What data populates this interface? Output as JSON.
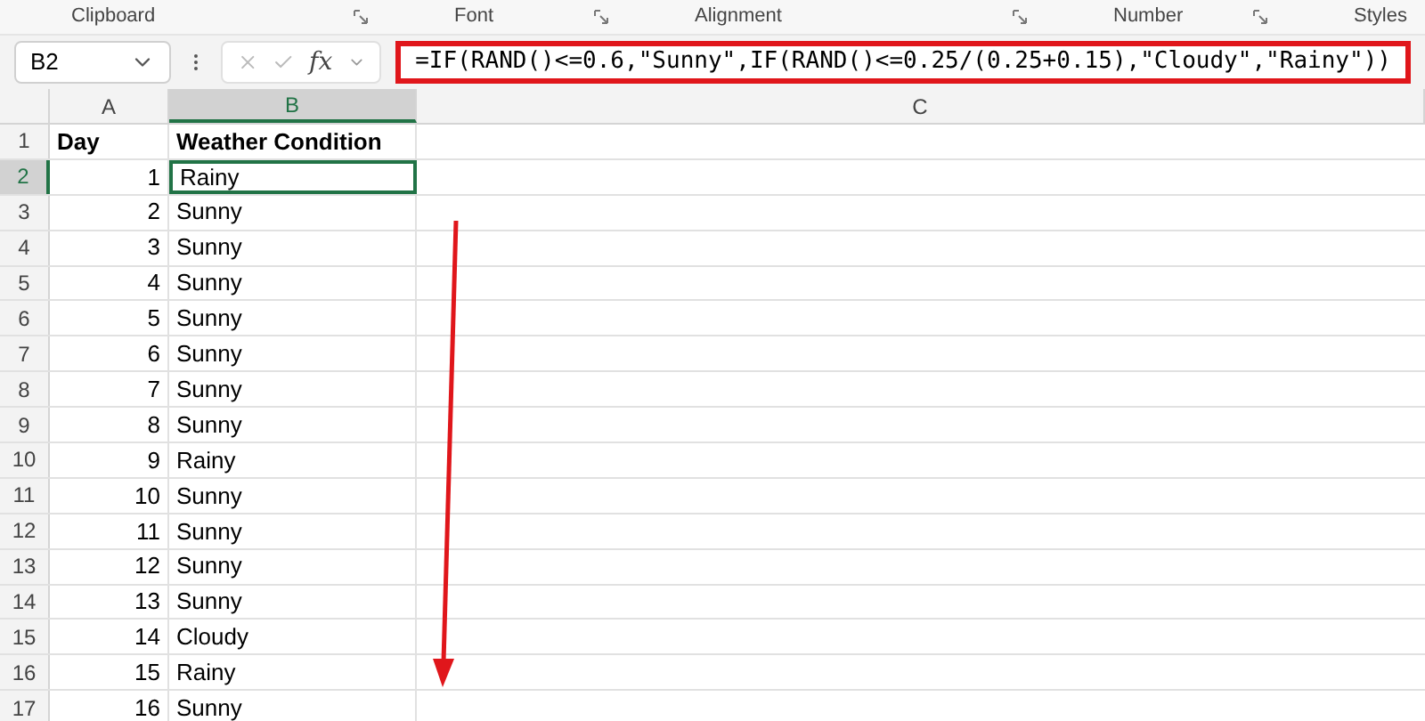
{
  "ribbon_groups": [
    "Clipboard",
    "Font",
    "Alignment",
    "Number",
    "Styles"
  ],
  "formula_bar": {
    "name_box": "B2",
    "fx": "fx",
    "formula": "=IF(RAND()<=0.6,\"Sunny\",IF(RAND()<=0.25/(0.25+0.15),\"Cloudy\",\"Rainy\"))",
    "highlighted": true
  },
  "columns": [
    {
      "label": "A",
      "selected": false
    },
    {
      "label": "B",
      "selected": true
    },
    {
      "label": "C",
      "selected": false
    }
  ],
  "rows": [
    {
      "number": "1",
      "day": "Day",
      "condition": "Weather Condition",
      "header": true,
      "selected": false
    },
    {
      "number": "2",
      "day": "1",
      "condition": "Rainy",
      "header": false,
      "selected": true
    },
    {
      "number": "3",
      "day": "2",
      "condition": "Sunny",
      "header": false,
      "selected": false
    },
    {
      "number": "4",
      "day": "3",
      "condition": "Sunny",
      "header": false,
      "selected": false
    },
    {
      "number": "5",
      "day": "4",
      "condition": "Sunny",
      "header": false,
      "selected": false
    },
    {
      "number": "6",
      "day": "5",
      "condition": "Sunny",
      "header": false,
      "selected": false
    },
    {
      "number": "7",
      "day": "6",
      "condition": "Sunny",
      "header": false,
      "selected": false
    },
    {
      "number": "8",
      "day": "7",
      "condition": "Sunny",
      "header": false,
      "selected": false
    },
    {
      "number": "9",
      "day": "8",
      "condition": "Sunny",
      "header": false,
      "selected": false
    },
    {
      "number": "10",
      "day": "9",
      "condition": "Rainy",
      "header": false,
      "selected": false
    },
    {
      "number": "11",
      "day": "10",
      "condition": "Sunny",
      "header": false,
      "selected": false
    },
    {
      "number": "12",
      "day": "11",
      "condition": "Sunny",
      "header": false,
      "selected": false
    },
    {
      "number": "13",
      "day": "12",
      "condition": "Sunny",
      "header": false,
      "selected": false
    },
    {
      "number": "14",
      "day": "13",
      "condition": "Sunny",
      "header": false,
      "selected": false
    },
    {
      "number": "15",
      "day": "14",
      "condition": "Cloudy",
      "header": false,
      "selected": false
    },
    {
      "number": "16",
      "day": "15",
      "condition": "Rainy",
      "header": false,
      "selected": false
    },
    {
      "number": "17",
      "day": "16",
      "condition": "Sunny",
      "header": false,
      "selected": false
    }
  ],
  "annotation": {
    "arrow": true
  }
}
